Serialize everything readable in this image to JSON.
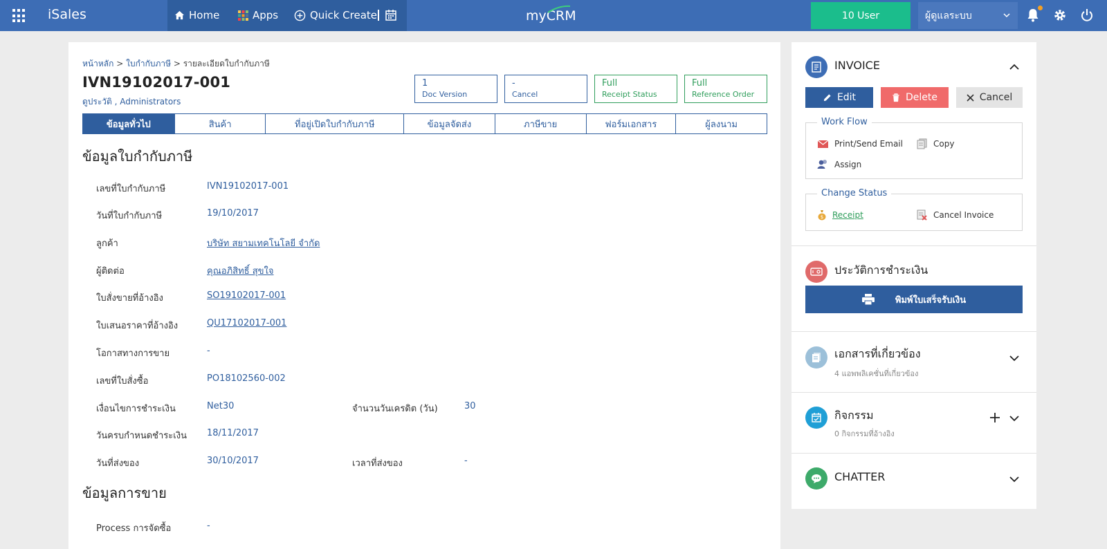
{
  "topbar": {
    "brand": "iSales",
    "nav": {
      "home": "Home",
      "apps": "Apps",
      "quick_create": "Quick Create"
    },
    "logo": "myCRM",
    "users_button": "10 User",
    "user_select": "ผู้ดูแลระบบ"
  },
  "header": {
    "breadcrumb": [
      "หน้าหลัก",
      "ใบกำกับภาษี",
      "รายละเอียดใบกำกับภาษี"
    ],
    "title": "IVN19102017-001",
    "history_link": "ดูประวัติ",
    "owner": "Administrators",
    "stats": [
      {
        "value": "1",
        "label": "Doc Version"
      },
      {
        "value": "-",
        "label": "Cancel"
      },
      {
        "value": "Full",
        "label": "Receipt Status"
      },
      {
        "value": "Full",
        "label": "Reference Order"
      }
    ]
  },
  "tabs": [
    "ข้อมูลทั่วไป",
    "สินค้า",
    "ที่อยู่เปิดใบกำกับภาษี",
    "ข้อมูลจัดส่ง",
    "ภาษีขาย",
    "ฟอร์มเอกสาร",
    "ผู้ลงนาม"
  ],
  "active_tab_index": 0,
  "invoice_info": {
    "title": "ข้อมูลใบกำกับภาษี",
    "fields": [
      {
        "label": "เลขที่ใบกำกับภาษี",
        "value": "IVN19102017-001"
      },
      {
        "label": "วันที่ใบกำกับภาษี",
        "value": "19/10/2017"
      },
      {
        "label": "ลูกค้า",
        "value": "บริษัท สยามเทคโนโลยี จำกัด"
      },
      {
        "label": "ผู้ติดต่อ",
        "value": "คุณอภิสิทธิ์ สุขใจ"
      },
      {
        "label": "ใบสั่งขายที่อ้างอิง",
        "value": "SO19102017-001"
      },
      {
        "label": "ใบเสนอราคาที่อ้างอิง",
        "value": "QU17102017-001"
      },
      {
        "label": "โอกาสทางการขาย",
        "value": "-"
      },
      {
        "label": "เลขที่ใบสั่งซื้อ",
        "value": "PO18102560-002"
      },
      {
        "label": "เงื่อนไขการชำระเงิน",
        "value": "Net30"
      },
      {
        "label": "วันครบกำหนดชำระเงิน",
        "value": "18/11/2017"
      },
      {
        "label": "วันที่ส่งของ",
        "value": "30/10/2017"
      }
    ],
    "extra_fields": [
      {
        "label": "จำนวนวันเครดิต (วัน)",
        "value": "30"
      },
      {
        "label": "เวลาที่ส่งของ",
        "value": "-"
      }
    ]
  },
  "sales_info": {
    "title": "ข้อมูลการขาย",
    "fields": [
      {
        "label": "Process การจัดซื้อ",
        "value": "-"
      }
    ]
  },
  "sidebar": {
    "invoice": {
      "title": "INVOICE",
      "edit": "Edit",
      "delete": "Delete",
      "cancel": "Cancel",
      "workflow_legend": "Work Flow",
      "print_send_email": "Print/Send Email",
      "copy": "Copy",
      "assign": "Assign",
      "change_status_legend": "Change Status",
      "receipt": "Receipt",
      "cancel_invoice": "Cancel Invoice"
    },
    "payment_history": {
      "title": "ประวัติการชำระเงิน",
      "print_button": "พิมพ์ใบเสร็จรับเงิน"
    },
    "related_docs": {
      "title": "เอกสารที่เกี่ยวข้อง",
      "subtitle": "4 แอพพลิเคชั่นที่เกี่ยวข้อง"
    },
    "activities": {
      "title": "กิจกรรม",
      "subtitle": "0 กิจกรรมที่อ้างอิง"
    },
    "chatter": {
      "title": "CHATTER"
    }
  }
}
